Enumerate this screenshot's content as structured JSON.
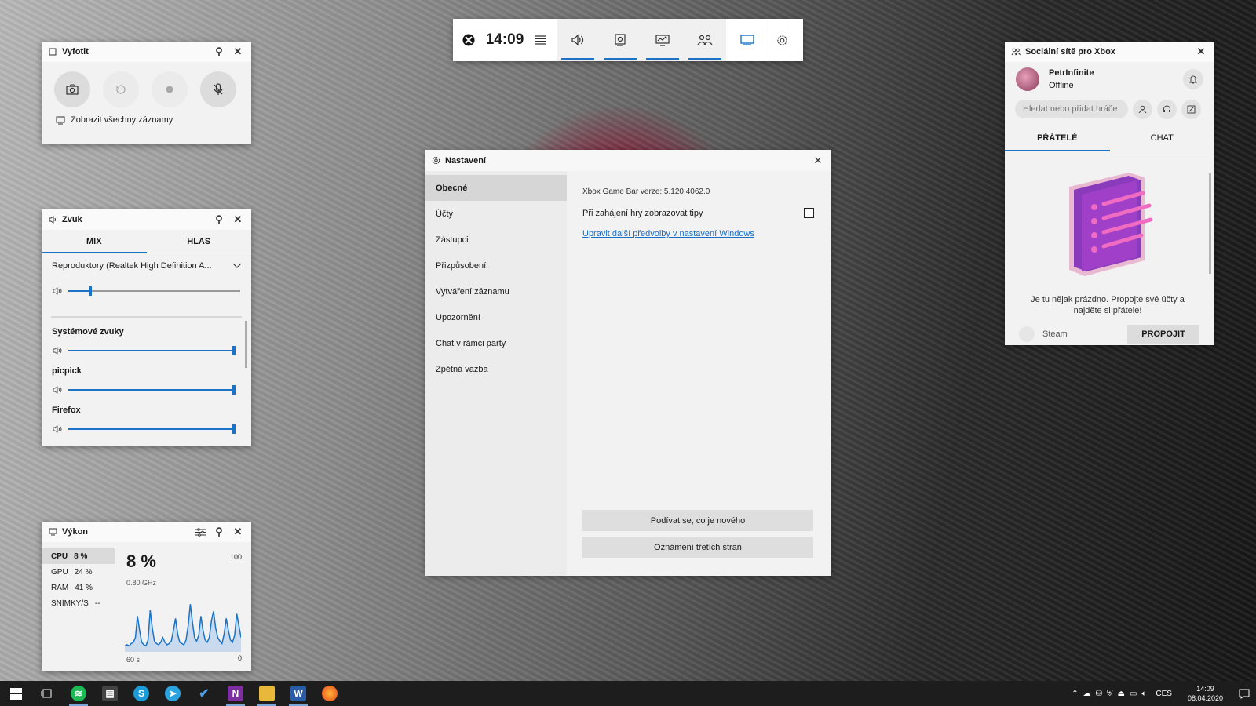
{
  "topbar": {
    "time": "14:09"
  },
  "capture": {
    "title": "Vyfotit",
    "view_all": "Zobrazit všechny záznamy"
  },
  "audio": {
    "title": "Zvuk",
    "tabs": [
      "MIX",
      "HLAS"
    ],
    "device": "Reproduktory (Realtek High Definition A...",
    "master_level": 0.13,
    "apps": [
      {
        "name": "Systémové zvuky",
        "level": 1.0
      },
      {
        "name": "picpick",
        "level": 1.0
      },
      {
        "name": "Firefox",
        "level": 1.0
      }
    ]
  },
  "performance": {
    "title": "Výkon",
    "rows": [
      {
        "label": "CPU",
        "value": "8 %"
      },
      {
        "label": "GPU",
        "value": "24 %"
      },
      {
        "label": "RAM",
        "value": "41 %"
      },
      {
        "label": "SNÍMKY/S",
        "value": "--"
      }
    ],
    "big_value": "8 %",
    "freq": "0.80 GHz",
    "max": "100",
    "min": "0",
    "time_span": "60 s",
    "history": [
      5,
      6,
      5,
      7,
      8,
      12,
      30,
      18,
      8,
      6,
      5,
      10,
      35,
      20,
      9,
      7,
      6,
      8,
      12,
      8,
      6,
      7,
      9,
      18,
      28,
      15,
      8,
      7,
      6,
      10,
      22,
      40,
      25,
      12,
      9,
      14,
      30,
      18,
      10,
      8,
      12,
      26,
      34,
      20,
      12,
      9,
      7,
      15,
      28,
      18,
      10,
      8,
      14,
      32,
      22,
      12
    ]
  },
  "settings": {
    "title": "Nastavení",
    "nav": [
      "Obecné",
      "Účty",
      "Zástupci",
      "Přizpůsobení",
      "Vytváření záznamu",
      "Upozornění",
      "Chat v rámci party",
      "Zpětná vazba"
    ],
    "version": "Xbox Game Bar verze: 5.120.4062.0",
    "tips_label": "Při zahájení hry zobrazovat tipy",
    "tips_checked": false,
    "link": "Upravit další předvolby v nastavení Windows",
    "btn_new": "Podívat se, co je nového",
    "btn_third": "Oznámení třetích stran"
  },
  "social": {
    "title": "Sociální sítě pro Xbox",
    "user": "PetrInfinite",
    "status": "Offline",
    "search_placeholder": "Hledat nebo přidat hráče",
    "tabs": [
      "PŘÁTELÉ",
      "CHAT"
    ],
    "empty_text": "Je tu nějak prázdno. Propojte své účty a najděte si přátele!",
    "account": "Steam",
    "connect": "PROPOJIT"
  },
  "tray": {
    "lang": "CES",
    "time": "14:09",
    "date": "08.04.2020"
  },
  "colors": {
    "accent": "#1a73c7",
    "panel": "#f2f2f2"
  }
}
